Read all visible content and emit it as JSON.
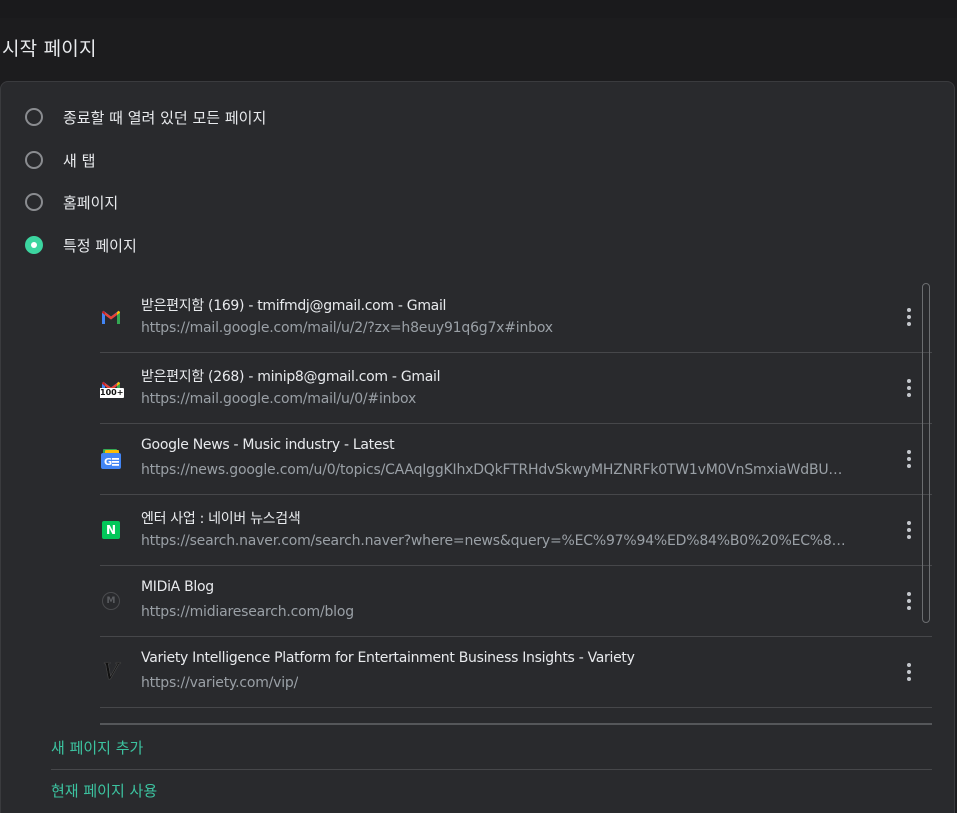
{
  "section": {
    "title": "시작 페이지"
  },
  "startup_options": [
    {
      "label": "종료할 때 열려 있던 모든 페이지",
      "checked": false
    },
    {
      "label": "새 탭",
      "checked": false
    },
    {
      "label": "홈페이지",
      "checked": false
    },
    {
      "label": "특정 페이지",
      "checked": true
    }
  ],
  "pages": [
    {
      "title": "받은편지함 (169) - tmifmdj@gmail.com - Gmail",
      "url": "https://mail.google.com/mail/u/2/?zx=h8euy91q6g7x#inbox",
      "icon": "gmail-icon"
    },
    {
      "title": "받은편지함 (268) - minip8@gmail.com - Gmail",
      "url": "https://mail.google.com/mail/u/0/#inbox",
      "icon": "gmail-100-icon",
      "badge": "100+"
    },
    {
      "title": "Google News - Music industry - Latest",
      "url": "https://news.google.com/u/0/topics/CAAqIggKIhxDQkFTRHdvSkwyMHZNRFk0TW1vM0VnSmxiaWdBUAE...",
      "icon": "google-news-icon"
    },
    {
      "title": "엔터 사업 : 네이버 뉴스검색",
      "url": "https://search.naver.com/search.naver?where=news&query=%EC%97%94%ED%84%B0%20%EC%82%AC%...",
      "icon": "naver-icon",
      "badge": "N"
    },
    {
      "title": "MIDiA Blog",
      "url": "https://midiaresearch.com/blog",
      "icon": "midia-icon",
      "badge": "M"
    },
    {
      "title": "Variety Intelligence Platform for Entertainment Business Insights - Variety",
      "url": "https://variety.com/vip/",
      "icon": "variety-icon",
      "badge": "V"
    }
  ],
  "actions": {
    "add_page": "새 페이지 추가",
    "use_current": "현재 페이지 사용"
  },
  "colors": {
    "accent": "#3cd5a0",
    "link": "#3cc3a0",
    "background": "#1c1c1e",
    "card": "#292a2d"
  }
}
